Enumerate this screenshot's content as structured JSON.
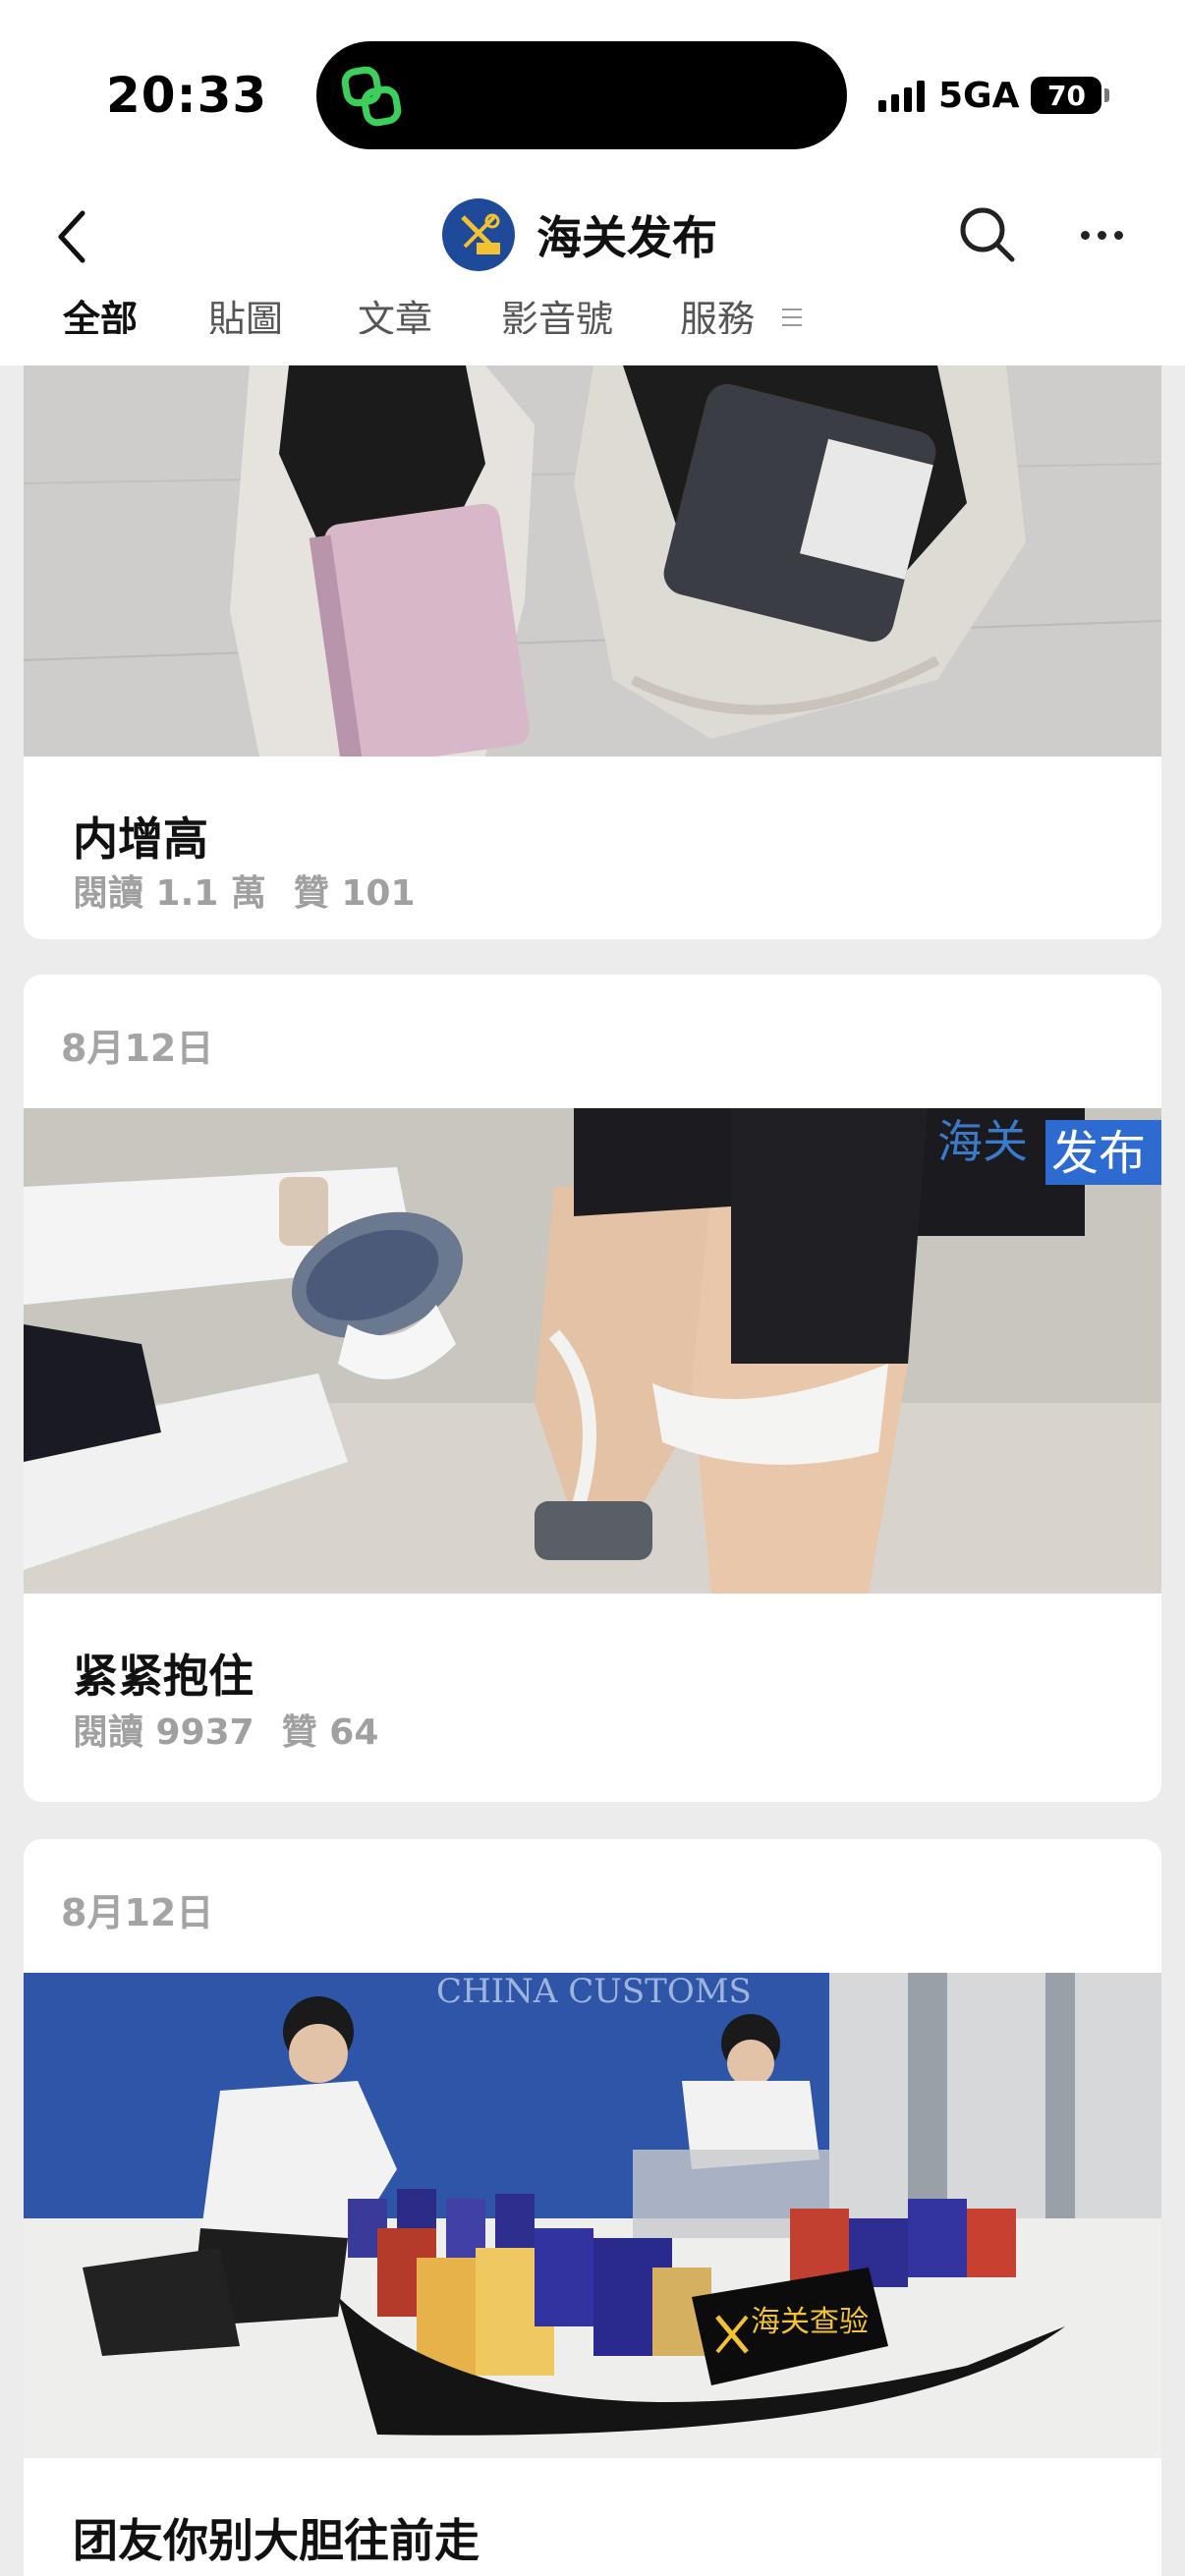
{
  "status_bar": {
    "time": "20:33",
    "network": "5GA",
    "battery": "70"
  },
  "header": {
    "account_name": "海关发布"
  },
  "tabs": [
    {
      "label": "全部",
      "active": true
    },
    {
      "label": "貼圖",
      "active": false
    },
    {
      "label": "文章",
      "active": false
    },
    {
      "label": "影音號",
      "active": false
    },
    {
      "label": "服務",
      "active": false
    }
  ],
  "articles": [
    {
      "date": "",
      "title": "内增高",
      "reads": "閱讀 1.1 萬",
      "likes": "贊 101"
    },
    {
      "date": "8月12日",
      "title": "紧紧抱住",
      "reads": "閱讀 9937",
      "likes": "贊 64",
      "watermark": "海关发布"
    },
    {
      "date": "8月12日",
      "title": "团友你别大胆往前走",
      "sign_text": "CHINA CUSTOMS",
      "badge_text": "海关查验"
    }
  ],
  "colors": {
    "accent": "#1f4a9a",
    "background": "#ececec",
    "meta_text": "#a0a0a0"
  }
}
